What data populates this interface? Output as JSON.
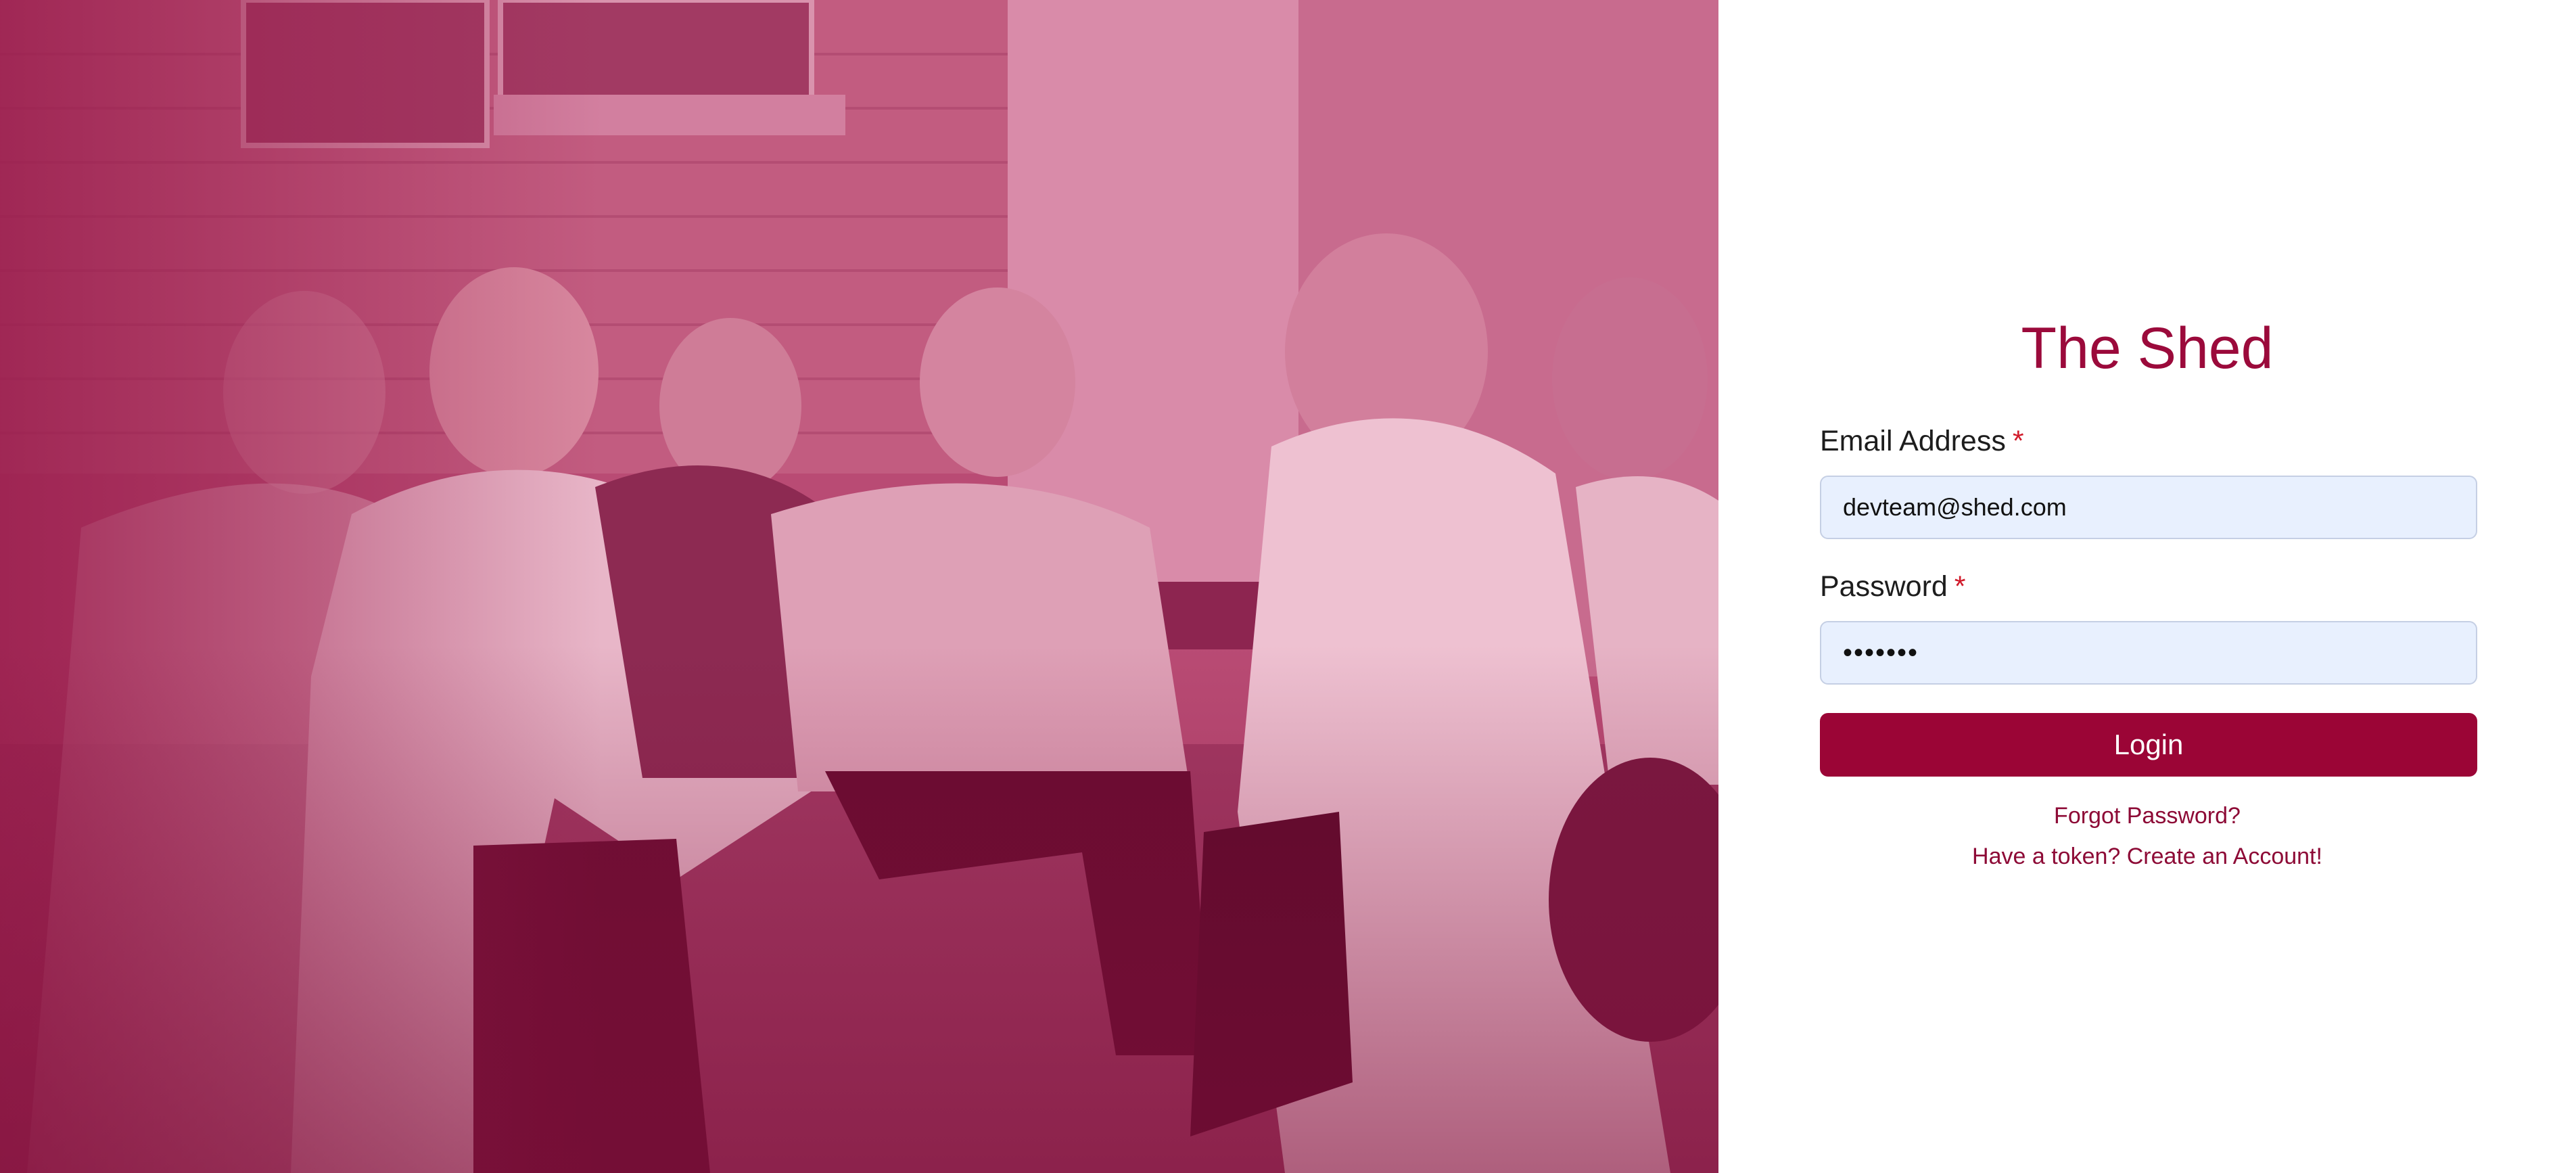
{
  "colors": {
    "brand": "#9b0536",
    "title": "#9b0a3b",
    "overlay": "#b94b74",
    "link": "#8d0a36",
    "required": "#d11a2a",
    "input_bg": "#e8f0fe"
  },
  "hero": {
    "image_icon": "people-photo"
  },
  "login": {
    "title": "The Shed",
    "email": {
      "label": "Email Address",
      "required_mark": "*",
      "value": "devteam@shed.com"
    },
    "password": {
      "label": "Password",
      "required_mark": "*",
      "value": "•••••••"
    },
    "submit_label": "Login",
    "forgot_link": "Forgot Password?",
    "create_link": "Have a token? Create an Account!"
  }
}
